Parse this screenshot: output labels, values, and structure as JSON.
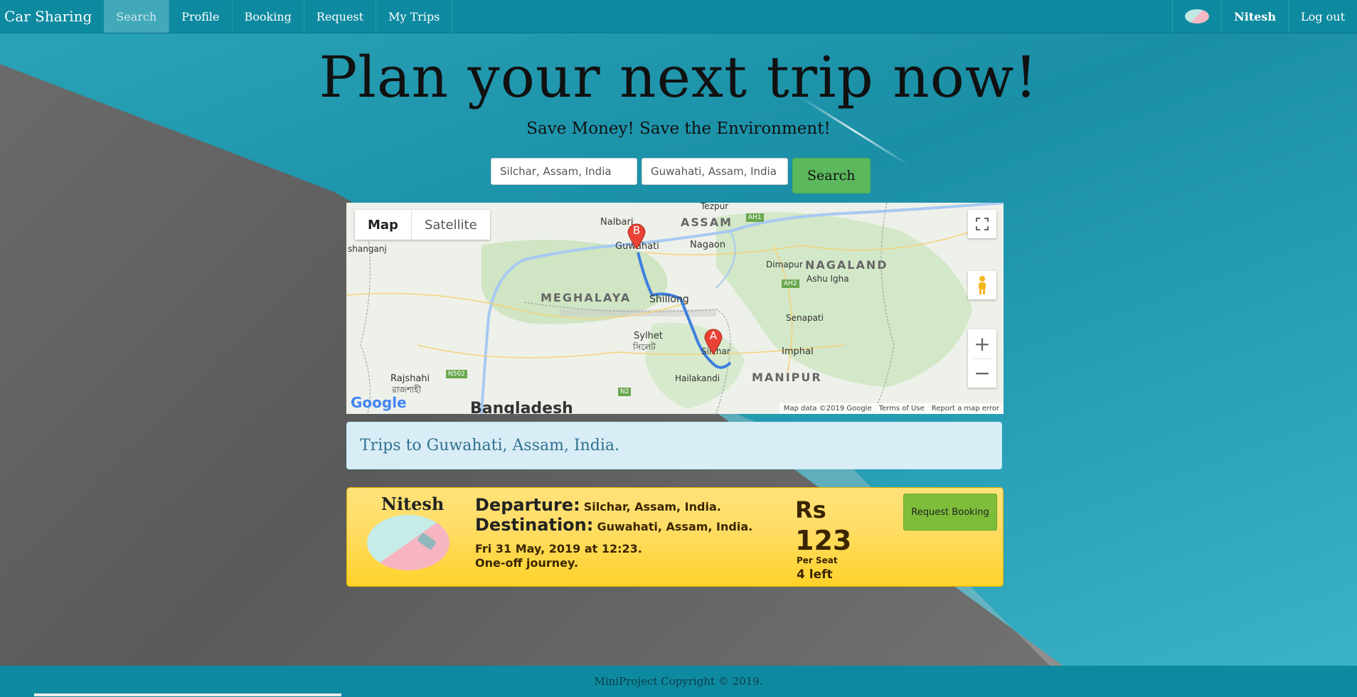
{
  "nav": {
    "brand": "Car Sharing",
    "items": [
      {
        "label": "Search",
        "active": true
      },
      {
        "label": "Profile"
      },
      {
        "label": "Booking"
      },
      {
        "label": "Request"
      },
      {
        "label": "My Trips"
      }
    ],
    "user": "Nitesh",
    "logout": "Log out"
  },
  "hero": {
    "title": "Plan your next trip now!",
    "subtitle": "Save Money! Save the Environment!"
  },
  "search": {
    "from_value": "Silchar, Assam, India",
    "to_value": "Guwahati, Assam, India",
    "button": "Search"
  },
  "map": {
    "type_map": "Map",
    "type_satellite": "Satellite",
    "zoom_in": "+",
    "zoom_out": "−",
    "google": "Google",
    "attribution": {
      "data": "Map data ©2019 Google",
      "terms": "Terms of Use",
      "report": "Report a map error"
    },
    "labels": {
      "tezpur": "Tezpur",
      "assam": "ASSAM",
      "guwahati": "Guwahati",
      "nagaon": "Nagaon",
      "nalbari": "Nalbari",
      "meghalaya": "MEGHALAYA",
      "shillong": "Shillong",
      "dimapur": "Dimapur",
      "nagaland": "NAGALAND",
      "ashu_igha": "Ashu Igha",
      "sylhet": "Sylhet",
      "sylhet_bn": "সিলেট",
      "silchar": "Silchar",
      "senapati": "Senapati",
      "imphal": "Imphal",
      "manipur": "MANIPUR",
      "hailakandi": "Hailakandi",
      "rajshahi": "Rajshahi",
      "rajshahi_bn": "রাজশাহী",
      "bangladesh": "Bangladesh",
      "n502": "N502",
      "n2": "N2",
      "ah1": "AH1",
      "ah2": "AH2",
      "shanganj": "shanganj",
      "marker_a": "A",
      "marker_b": "B"
    }
  },
  "result_banner": "Trips to Guwahati, Assam, India.",
  "trip": {
    "driver": "Nitesh",
    "departure_label": "Departure:",
    "departure": "Silchar, Assam, India.",
    "destination_label": "Destination:",
    "destination": "Guwahati, Assam, India.",
    "when": "Fri 31 May, 2019 at 12:23.",
    "kind": "One-off journey.",
    "currency": "Rs",
    "price": "123",
    "per_seat": "Per Seat",
    "seats_left": "4 left",
    "request_button": "Request Booking"
  },
  "footer": "MiniProject Copyright © 2019.",
  "colors": {
    "nav": "#0e8aa0",
    "search_button": "#5cb85c",
    "card": "#ffdd66",
    "info_bg": "#d9edf7"
  }
}
